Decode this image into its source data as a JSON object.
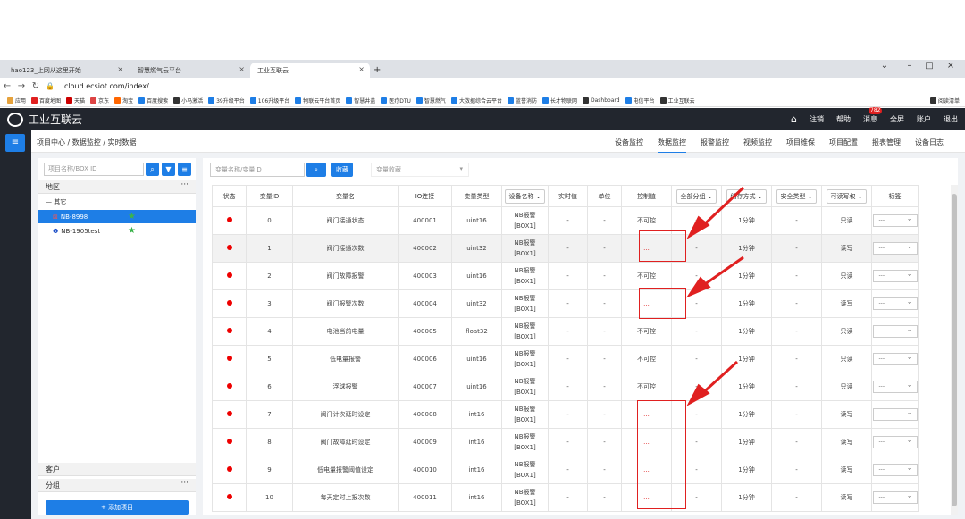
{
  "browser": {
    "tabs": [
      {
        "label": "hao123_上网从这里开始"
      },
      {
        "label": "智慧燃气云平台"
      },
      {
        "label": "工业互联云"
      }
    ],
    "url": "cloud.ecsiot.com/index/",
    "bookmarks": [
      "应用",
      "百度地图",
      "天猫",
      "京东",
      "淘宝",
      "百度搜索",
      "小马激活",
      "39升级平台",
      "106升级平台",
      "物联云平台首页",
      "智慧井盖",
      "医疗DTU",
      "智慧燃气",
      "大数据综合云平台",
      "蓝誉消防",
      "长才物联网",
      "Dashboard",
      "电信平台",
      "工业互联云",
      "阅读清单"
    ]
  },
  "app": {
    "title": "工业互联云",
    "menu": [
      "注销",
      "帮助",
      "消息",
      "全屏",
      "账户",
      "退出"
    ],
    "msg_count": "782"
  },
  "breadcrumb": "项目中心 / 数据监控 / 实时数据",
  "navtabs": [
    "设备监控",
    "数据监控",
    "报警监控",
    "视频监控",
    "项目维保",
    "项目配置",
    "报表管理",
    "设备日志"
  ],
  "left": {
    "search_placeholder": "项目名称/BOX ID",
    "region": "地区",
    "group_other": "其它",
    "nodes": [
      "NB-8998",
      "NB-1905test"
    ],
    "customers": "客户",
    "groups": "分组",
    "add_project": "添加项目"
  },
  "right": {
    "var_placeholder": "变量名称/变量ID",
    "fav_label": "收藏",
    "fav_select": "变量收藏",
    "columns": [
      "状态",
      "变量ID",
      "变量名",
      "IO连接",
      "变量类型",
      "设备名称",
      "实时值",
      "单位",
      "控制值",
      "全部分组",
      "储存方式",
      "安全类型",
      "可读写权",
      "标签"
    ],
    "rows": [
      {
        "id": "0",
        "name": "阀门接通状态",
        "io": "400001",
        "type": "uint16",
        "dev": "NB报警",
        "box": "[BOX1]",
        "rt": "-",
        "unit": "-",
        "ctrl": "不可控",
        "grp": "-",
        "store": "1分钟",
        "safe": "-",
        "rw": "只读",
        "tag": "---"
      },
      {
        "id": "1",
        "name": "阀门接通次数",
        "io": "400002",
        "type": "uint32",
        "dev": "NB报警",
        "box": "[BOX1]",
        "rt": "-",
        "unit": "-",
        "ctrl": "...",
        "grp": "-",
        "store": "1分钟",
        "safe": "-",
        "rw": "读写",
        "tag": "---"
      },
      {
        "id": "2",
        "name": "阀门故障报警",
        "io": "400003",
        "type": "uint16",
        "dev": "NB报警",
        "box": "[BOX1]",
        "rt": "-",
        "unit": "-",
        "ctrl": "不可控",
        "grp": "-",
        "store": "1分钟",
        "safe": "-",
        "rw": "只读",
        "tag": "---"
      },
      {
        "id": "3",
        "name": "阀门报警次数",
        "io": "400004",
        "type": "uint32",
        "dev": "NB报警",
        "box": "[BOX1]",
        "rt": "-",
        "unit": "-",
        "ctrl": "...",
        "grp": "-",
        "store": "1分钟",
        "safe": "-",
        "rw": "读写",
        "tag": "---"
      },
      {
        "id": "4",
        "name": "电池当前电量",
        "io": "400005",
        "type": "float32",
        "dev": "NB报警",
        "box": "[BOX1]",
        "rt": "-",
        "unit": "-",
        "ctrl": "不可控",
        "grp": "-",
        "store": "1分钟",
        "safe": "-",
        "rw": "只读",
        "tag": "---"
      },
      {
        "id": "5",
        "name": "低电量报警",
        "io": "400006",
        "type": "uint16",
        "dev": "NB报警",
        "box": "[BOX1]",
        "rt": "-",
        "unit": "-",
        "ctrl": "不可控",
        "grp": "-",
        "store": "1分钟",
        "safe": "-",
        "rw": "只读",
        "tag": "---"
      },
      {
        "id": "6",
        "name": "浮球报警",
        "io": "400007",
        "type": "uint16",
        "dev": "NB报警",
        "box": "[BOX1]",
        "rt": "-",
        "unit": "-",
        "ctrl": "不可控",
        "grp": "-",
        "store": "1分钟",
        "safe": "-",
        "rw": "只读",
        "tag": "---"
      },
      {
        "id": "7",
        "name": "阀门计次延时设定",
        "io": "400008",
        "type": "int16",
        "dev": "NB报警",
        "box": "[BOX1]",
        "rt": "-",
        "unit": "-",
        "ctrl": "...",
        "grp": "-",
        "store": "1分钟",
        "safe": "-",
        "rw": "读写",
        "tag": "---"
      },
      {
        "id": "8",
        "name": "阀门故障延时设定",
        "io": "400009",
        "type": "int16",
        "dev": "NB报警",
        "box": "[BOX1]",
        "rt": "-",
        "unit": "-",
        "ctrl": "...",
        "grp": "-",
        "store": "1分钟",
        "safe": "-",
        "rw": "读写",
        "tag": "---"
      },
      {
        "id": "9",
        "name": "低电量报警阈值设定",
        "io": "400010",
        "type": "int16",
        "dev": "NB报警",
        "box": "[BOX1]",
        "rt": "-",
        "unit": "-",
        "ctrl": "...",
        "grp": "-",
        "store": "1分钟",
        "safe": "-",
        "rw": "读写",
        "tag": "---"
      },
      {
        "id": "10",
        "name": "每天定时上报次数",
        "io": "400011",
        "type": "int16",
        "dev": "NB报警",
        "box": "[BOX1]",
        "rt": "-",
        "unit": "-",
        "ctrl": "...",
        "grp": "-",
        "store": "1分钟",
        "safe": "-",
        "rw": "读写",
        "tag": "---"
      }
    ]
  },
  "colors": {
    "accent": "#1e7ee6",
    "header": "#22262e",
    "alert": "#e02020"
  }
}
